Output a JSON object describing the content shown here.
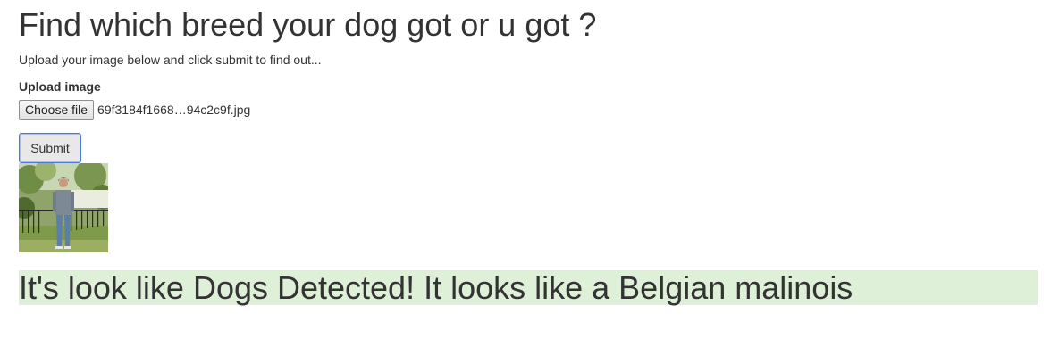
{
  "header": {
    "title": "Find which breed your dog got or u got ?",
    "subtitle": "Upload your image below and click submit to find out..."
  },
  "form": {
    "upload_label": "Upload image",
    "choose_file_label": "Choose file",
    "file_name": "69f3184f1668…94c2c9f.jpg",
    "submit_label": "Submit"
  },
  "result": {
    "text": "It's look like Dogs Detected! It looks like a Belgian malinois",
    "background": "#dff0d8"
  },
  "colors": {
    "text": "#333333",
    "focus_border": "#4a7ad6"
  }
}
